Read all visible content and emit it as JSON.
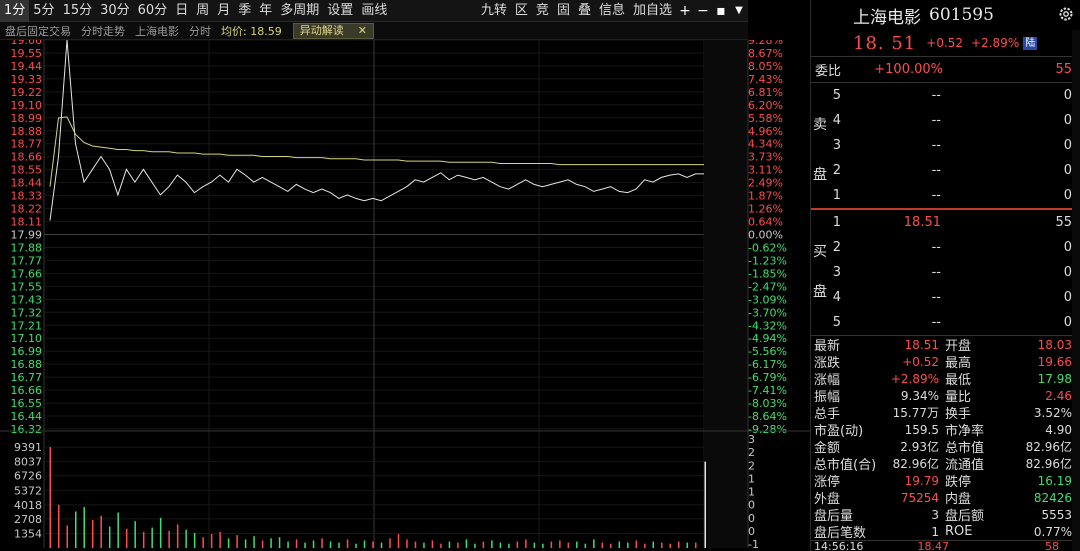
{
  "toolbar": {
    "periods": [
      "1分",
      "5分",
      "15分",
      "30分",
      "60分",
      "日",
      "周",
      "月",
      "季",
      "年",
      "多周期",
      "设置",
      "画线"
    ],
    "tools": [
      "九转",
      "区",
      "竞",
      "固",
      "叠",
      "信息",
      "加自选"
    ]
  },
  "subheader": {
    "items": [
      "盘后固定交易",
      "分时走势",
      "上海电影",
      "分时"
    ],
    "avg_label": "均价: 18.59",
    "anomaly": "异动解读"
  },
  "chart_data": {
    "type": "line",
    "ylim": [
      16.32,
      19.66
    ],
    "prev_close": 17.99,
    "price_ticks": [
      "19.66",
      "19.55",
      "19.44",
      "19.33",
      "19.22",
      "19.10",
      "18.99",
      "18.88",
      "18.77",
      "18.66",
      "18.55",
      "18.44",
      "18.33",
      "18.22",
      "18.11",
      "17.99",
      "17.88",
      "17.77",
      "17.66",
      "17.55",
      "17.43",
      "17.32",
      "17.21",
      "17.10",
      "16.99",
      "16.88",
      "16.77",
      "16.66",
      "16.55",
      "16.44",
      "16.32"
    ],
    "pct_ticks": [
      "9.28%",
      "8.67%",
      "8.05%",
      "7.43%",
      "6.81%",
      "6.20%",
      "5.58%",
      "4.96%",
      "4.34%",
      "3.73%",
      "3.11%",
      "2.49%",
      "1.87%",
      "1.26%",
      "0.64%",
      "0.00%",
      "-0.62%",
      "-1.23%",
      "-1.85%",
      "-2.47%",
      "-3.09%",
      "-3.70%",
      "-4.32%",
      "-4.94%",
      "-5.56%",
      "-6.17%",
      "-6.79%",
      "-7.41%",
      "-8.03%",
      "-8.64%",
      "-9.28%"
    ],
    "price_series": [
      18.11,
      18.66,
      19.66,
      18.77,
      18.44,
      18.55,
      18.66,
      18.55,
      18.33,
      18.55,
      18.44,
      18.55,
      18.44,
      18.33,
      18.4,
      18.5,
      18.44,
      18.35,
      18.4,
      18.44,
      18.5,
      18.44,
      18.55,
      18.5,
      18.44,
      18.48,
      18.44,
      18.4,
      18.36,
      18.42,
      18.38,
      18.35,
      18.38,
      18.35,
      18.3,
      18.33,
      18.3,
      18.28,
      18.3,
      18.28,
      18.32,
      18.36,
      18.4,
      18.46,
      18.44,
      18.48,
      18.52,
      18.46,
      18.5,
      18.48,
      18.46,
      18.48,
      18.44,
      18.4,
      18.38,
      18.42,
      18.46,
      18.42,
      18.4,
      18.42,
      18.44,
      18.46,
      18.42,
      18.4,
      18.36,
      18.38,
      18.4,
      18.36,
      18.35,
      18.38,
      18.46,
      18.44,
      18.48,
      18.5,
      18.51,
      18.48,
      18.51,
      18.51
    ],
    "avg_series": [
      18.4,
      18.99,
      19.0,
      18.85,
      18.78,
      18.75,
      18.74,
      18.73,
      18.72,
      18.72,
      18.71,
      18.71,
      18.7,
      18.7,
      18.7,
      18.69,
      18.69,
      18.69,
      18.68,
      18.68,
      18.68,
      18.67,
      18.67,
      18.67,
      18.67,
      18.66,
      18.66,
      18.66,
      18.66,
      18.65,
      18.65,
      18.65,
      18.65,
      18.64,
      18.64,
      18.64,
      18.64,
      18.63,
      18.63,
      18.63,
      18.63,
      18.63,
      18.62,
      18.62,
      18.62,
      18.62,
      18.62,
      18.61,
      18.61,
      18.61,
      18.61,
      18.61,
      18.61,
      18.6,
      18.6,
      18.6,
      18.6,
      18.6,
      18.6,
      18.6,
      18.59,
      18.59,
      18.59,
      18.59,
      18.59,
      18.59,
      18.59,
      18.59,
      18.59,
      18.59,
      18.59,
      18.59,
      18.59,
      18.59,
      18.59,
      18.59,
      18.59,
      18.59
    ],
    "volume_ticks": [
      "9391",
      "8037",
      "6726",
      "5372",
      "4018",
      "2708",
      "1354"
    ],
    "ratio_ticks": [
      "3",
      "2",
      "2",
      "1",
      "1",
      "0",
      "0",
      "0",
      "-1"
    ],
    "volumes": [
      9391,
      4018,
      2100,
      3400,
      3800,
      2600,
      3000,
      2000,
      3300,
      1800,
      2500,
      1500,
      1900,
      2800,
      1600,
      2200,
      1700,
      1400,
      1000,
      1300,
      1500,
      900,
      1200,
      800,
      1100,
      700,
      900,
      1000,
      600,
      800,
      500,
      700,
      900,
      600,
      500,
      800,
      400,
      700,
      600,
      500,
      900,
      1300,
      800,
      600,
      500,
      700,
      400,
      600,
      500,
      800,
      400,
      600,
      700,
      500,
      400,
      600,
      800,
      500,
      400,
      600,
      700,
      500,
      600,
      400,
      800,
      500,
      400,
      600,
      500,
      700,
      400,
      600,
      500,
      400,
      600,
      500,
      500,
      8037
    ]
  },
  "quote": {
    "name": "上海电影",
    "code": "601595",
    "price": "18. 51",
    "change": "+0.52",
    "pct": "+2.89%",
    "badge": "陆"
  },
  "weibi": {
    "label": "委比",
    "pct": "+100.00%",
    "diff": "55"
  },
  "sell": {
    "side_label": [
      "卖",
      "盘"
    ],
    "rows": [
      {
        "lvl": "5",
        "price": "--",
        "qty": "0"
      },
      {
        "lvl": "4",
        "price": "--",
        "qty": "0"
      },
      {
        "lvl": "3",
        "price": "--",
        "qty": "0"
      },
      {
        "lvl": "2",
        "price": "--",
        "qty": "0"
      },
      {
        "lvl": "1",
        "price": "--",
        "qty": "0"
      }
    ]
  },
  "buy": {
    "side_label": [
      "买",
      "盘"
    ],
    "rows": [
      {
        "lvl": "1",
        "price": "18.51",
        "qty": "55"
      },
      {
        "lvl": "2",
        "price": "--",
        "qty": "0"
      },
      {
        "lvl": "3",
        "price": "--",
        "qty": "0"
      },
      {
        "lvl": "4",
        "price": "--",
        "qty": "0"
      },
      {
        "lvl": "5",
        "price": "--",
        "qty": "0"
      }
    ]
  },
  "stats": [
    {
      "l": "最新",
      "lv": "18.51",
      "lc": "red",
      "r": "开盘",
      "rv": "18.03",
      "rc": "red"
    },
    {
      "l": "涨跌",
      "lv": "+0.52",
      "lc": "red",
      "r": "最高",
      "rv": "19.66",
      "rc": "red"
    },
    {
      "l": "涨幅",
      "lv": "+2.89%",
      "lc": "red",
      "r": "最低",
      "rv": "17.98",
      "rc": "green"
    },
    {
      "l": "振幅",
      "lv": "9.34%",
      "lc": "white",
      "r": "量比",
      "rv": "2.46",
      "rc": "red"
    },
    {
      "l": "总手",
      "lv": "15.77万",
      "lc": "white",
      "r": "换手",
      "rv": "3.52%",
      "rc": "white"
    },
    {
      "l": "市盈(动)",
      "lv": "159.5",
      "lc": "white",
      "r": "市净率",
      "rv": "4.90",
      "rc": "white"
    },
    {
      "l": "金额",
      "lv": "2.93亿",
      "lc": "white",
      "r": "总市值",
      "rv": "82.96亿",
      "rc": "white"
    },
    {
      "l": "总市值(合)",
      "lv": "82.96亿",
      "lc": "white",
      "r": "流通值",
      "rv": "82.96亿",
      "rc": "white"
    },
    {
      "l": "涨停",
      "lv": "19.79",
      "lc": "red",
      "r": "跌停",
      "rv": "16.19",
      "rc": "green"
    },
    {
      "l": "外盘",
      "lv": "75254",
      "lc": "red",
      "r": "内盘",
      "rv": "82426",
      "rc": "green"
    },
    {
      "l": "盘后量",
      "lv": "3",
      "lc": "white",
      "r": "盘后额",
      "rv": "5553",
      "rc": "white"
    },
    {
      "l": "盘后笔数",
      "lv": "1",
      "lc": "white",
      "r": "ROE",
      "rv": "0.77%",
      "rc": "white"
    }
  ],
  "tick": {
    "time": "14:56:16",
    "price": "18.47",
    "vol": "58"
  },
  "colors": {
    "price_line": "#e6e6e6",
    "avg_line": "#d8d47a",
    "up": "#ff4d4d",
    "down": "#3ee06e",
    "grid": "#1e1e1e"
  }
}
